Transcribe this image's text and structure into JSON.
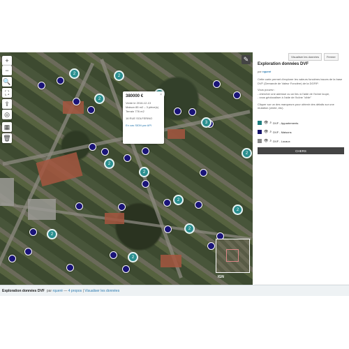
{
  "map": {
    "controls": [
      "+",
      "−",
      "🔍",
      "⛶",
      "⇪",
      "◎",
      "▦",
      "🗑"
    ],
    "pencil_icon": "✎",
    "popup": {
      "close": "×",
      "price": "380000 €",
      "date": "Vente le 2016-12-13",
      "maison": "Maison 85 m2 – 3 pièce(s)",
      "terrain": "Terrain 776 m2",
      "address": "16 RUE SOLFERINO",
      "link": "En cas SIDN par API"
    },
    "attribution": "IGN"
  },
  "panel": {
    "buttons": [
      "Visualiser les données",
      "Fermer"
    ],
    "title": "Exploration données DVF",
    "by_label": "par",
    "author": "rqueré",
    "description": [
      "Cette carte permet d'explorer les valeurs foncières issues de la base DVF (Demande de Valeur Foncière) de la DGFIP.",
      "Vous pouvez :",
      "- chercher une adresse ou un lieu à l'aide de l'icône loupe,",
      "- vous géolocaliser à l'aide de l'icône \"cible\"",
      "Cliquer sur un des marqueurs pour obtenir des détails sur une mutation (vente, etc)."
    ],
    "layers": [
      {
        "label": "DVF - Appartements",
        "color": "#1f7f7f"
      },
      {
        "label": "DVF - Maisons",
        "color": "#14126b"
      },
      {
        "label": "DVF - Locaux",
        "color": "#8a8a8a"
      }
    ],
    "search_button": "CHERS"
  },
  "footer": {
    "title": "Exploration données DVF",
    "by": "par",
    "author": "rqueré",
    "sep1": "—",
    "layers": "4 propos",
    "sep2": "|",
    "link": "Visualiser les données"
  }
}
